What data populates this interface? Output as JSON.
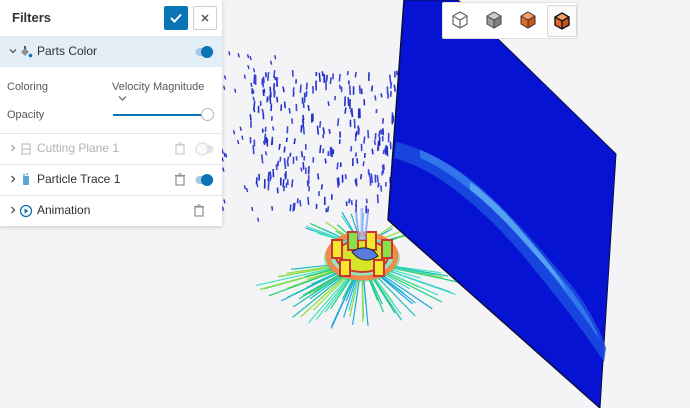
{
  "panel": {
    "title": "Filters",
    "confirm_icon": "check-icon",
    "close_icon": "close-icon",
    "accent": "#0a74b4"
  },
  "filters": [
    {
      "label": "Parts Color",
      "icon": "paint-icon",
      "expanded": true,
      "enabled": true,
      "active": true
    },
    {
      "label": "Cutting Plane 1",
      "icon": "cutting-plane-icon",
      "expanded": false,
      "enabled": false
    },
    {
      "label": "Particle Trace 1",
      "icon": "particle-trace-icon",
      "expanded": false,
      "enabled": true
    },
    {
      "label": "Animation",
      "icon": "play-icon",
      "expanded": false
    }
  ],
  "parts_color": {
    "coloring_label": "Coloring",
    "coloring_value": "Velocity Magnitude",
    "opacity_label": "Opacity",
    "opacity_value": 1.0
  },
  "view_toolbar": {
    "buttons": [
      "cube-outline-icon",
      "cube-shaded-icon",
      "cube-orange-icon",
      "cube-orange-selected-icon"
    ],
    "selected_index": 3
  }
}
